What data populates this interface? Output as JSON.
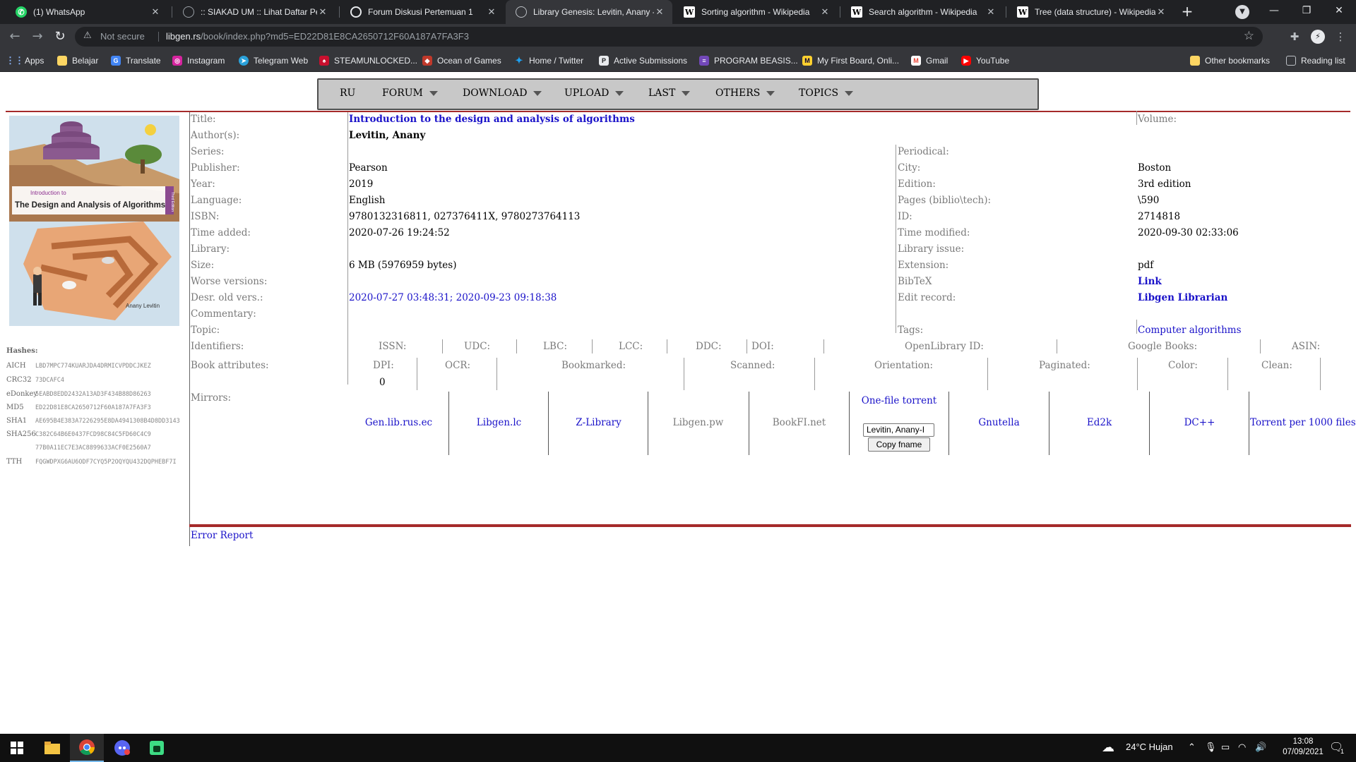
{
  "browser": {
    "tabs": [
      {
        "title": "(1) WhatsApp",
        "favicon": "whatsapp-icon",
        "color": "#25d366"
      },
      {
        "title": ":: SIAKAD UM :: Lihat Daftar Pe",
        "favicon": "globe-icon",
        "color": "#9aa0a6"
      },
      {
        "title": "Forum Diskusi Pertemuan 1",
        "favicon": "moodle-icon",
        "color": "#f98012"
      },
      {
        "title": "Library Genesis: Levitin, Anany -",
        "favicon": "globe-icon",
        "color": "#9aa0a6"
      },
      {
        "title": "Sorting algorithm - Wikipedia",
        "favicon": "wikipedia-icon",
        "color": "#ffffff"
      },
      {
        "title": "Search algorithm - Wikipedia",
        "favicon": "wikipedia-icon",
        "color": "#ffffff"
      },
      {
        "title": "Tree (data structure) - Wikipedia",
        "favicon": "wikipedia-icon",
        "color": "#ffffff"
      }
    ],
    "active_tab": 3,
    "not_secure": "Not secure",
    "url_host": "libgen.rs",
    "url_path": "/book/index.php?md5=ED22D81E8CA2650712F60A187A7FA3F3",
    "bookmarks": [
      {
        "label": "Apps",
        "icon": "apps-grid-icon",
        "color": "#4285f4"
      },
      {
        "label": "Belajar",
        "icon": "folder-icon",
        "color": "#fdd663"
      },
      {
        "label": "Translate",
        "icon": "translate-icon",
        "color": "#4285f4"
      },
      {
        "label": "Instagram",
        "icon": "instagram-icon",
        "color": "#d6249f"
      },
      {
        "label": "Telegram Web",
        "icon": "telegram-icon",
        "color": "#2aa1da"
      },
      {
        "label": "STEAMUNLOCKED...",
        "icon": "steamunlocked-icon",
        "color": "#c8102e"
      },
      {
        "label": "Ocean of Games",
        "icon": "ocean-of-games-icon",
        "color": "#c0392b"
      },
      {
        "label": "Home / Twitter",
        "icon": "twitter-icon",
        "color": "#1da1f2"
      },
      {
        "label": "Active Submissions",
        "icon": "submissions-icon",
        "color": "#e8eaed"
      },
      {
        "label": "PROGRAM BEASIS...",
        "icon": "form-icon",
        "color": "#7248b9"
      },
      {
        "label": "My First Board, Onli...",
        "icon": "miro-icon",
        "color": "#ffd02f"
      },
      {
        "label": "Gmail",
        "icon": "gmail-icon",
        "color": "#ea4335"
      },
      {
        "label": "YouTube",
        "icon": "youtube-icon",
        "color": "#ff0000"
      }
    ],
    "other_bookmarks": "Other bookmarks",
    "reading_list": "Reading list"
  },
  "menu": [
    {
      "label": "RU",
      "caret": false
    },
    {
      "label": "FORUM",
      "caret": true
    },
    {
      "label": "DOWNLOAD",
      "caret": true
    },
    {
      "label": "UPLOAD",
      "caret": true
    },
    {
      "label": "LAST",
      "caret": true
    },
    {
      "label": "OTHERS",
      "caret": true
    },
    {
      "label": "TOPICS",
      "caret": true
    }
  ],
  "cover": {
    "line1": "Introduction to",
    "line2": "The Design and Analysis of Algorithms",
    "edition": "Third Edition",
    "author": "Anany Levitin"
  },
  "book": {
    "title_label": "Title:",
    "title": "Introduction to the design and analysis of algorithms",
    "volume_label": "Volume:",
    "authors_label": "Author(s):",
    "authors": "Levitin, Anany",
    "series_label": "Series:",
    "periodical_label": "Periodical:",
    "publisher_label": "Publisher:",
    "publisher": "Pearson",
    "city_label": "City:",
    "city": "Boston",
    "year_label": "Year:",
    "year": "2019",
    "edition_label": "Edition:",
    "edition": "3rd edition",
    "language_label": "Language:",
    "language": "English",
    "pages_label": "Pages (biblio\\tech):",
    "pages": "\\590",
    "isbn_label": "ISBN:",
    "isbn": "9780132316811, 027376411X, 9780273764113",
    "id_label": "ID:",
    "id": "2714818",
    "time_added_label": "Time added:",
    "time_added": "2020-07-26 19:24:52",
    "time_modified_label": "Time modified:",
    "time_modified": "2020-09-30 02:33:06",
    "library_label": "Library:",
    "library_issue_label": "Library issue:",
    "size_label": "Size:",
    "size": "6 MB (5976959 bytes)",
    "extension_label": "Extension:",
    "extension": "pdf",
    "worse_versions_label": "Worse versions:",
    "bibtex_label": "BibTeX",
    "bibtex": "Link",
    "desr_label": "Desr. old vers.:",
    "desr_1": "2020-07-27 03:48:31",
    "desr_sep": "; ",
    "desr_2": "2020-09-23 09:18:38",
    "edit_record_label": "Edit record:",
    "edit_record": "Libgen Librarian",
    "commentary_label": "Commentary:",
    "topic_label": "Topic:",
    "tags_label": "Tags:",
    "tags": "Computer algorithms",
    "identifiers_label": "Identifiers:",
    "identifiers": [
      "ISSN:",
      "UDC:",
      "LBC:",
      "LCC:",
      "DDC:",
      "DOI:",
      "OpenLibrary ID:",
      "Google Books:",
      "ASIN:"
    ],
    "attributes_label": "Book attributes:",
    "attributes": [
      "DPI:",
      "OCR:",
      "Bookmarked:",
      "Scanned:",
      "Orientation:",
      "Paginated:",
      "Color:",
      "Clean:"
    ],
    "dpi_value": "0",
    "mirrors_label": "Mirrors:",
    "mirrors": [
      "Gen.lib.rus.ec",
      "Libgen.lc",
      "Z-Library",
      "Libgen.pw",
      "BookFI.net",
      "One-file torrent",
      "Gnutella",
      "Ed2k",
      "DC++",
      "Torrent per 1000 files"
    ],
    "fname_value": "Levitin, Anany-I",
    "copy_fname": "Copy fname",
    "error_report": "Error Report"
  },
  "hashes": {
    "title": "Hashes:",
    "items": [
      {
        "label": "AICH",
        "value": "LBD7MPC774KUARJDA4DRMICVPDDCJKEZ"
      },
      {
        "label": "CRC32",
        "value": "73DCAFC4"
      },
      {
        "label": "eDonkey",
        "value": "5EABD8EDD2432A13AD3F434B88D86263"
      },
      {
        "label": "MD5",
        "value": "ED22D81E8CA2650712F60A187A7FA3F3"
      },
      {
        "label": "SHA1",
        "value": "AE695B4E383A7226295E8DA4941308B4D8DD3143"
      },
      {
        "label": "SHA256",
        "value": "C382C64B6E0437FCD98C84C5FD60C4C9"
      },
      {
        "label": "",
        "value": "77B0A11EC7E3AC8899633ACF0E2560A7"
      },
      {
        "label": "TTH",
        "value": "FQGWDPXG6AU6ODF7CYQ5P2OQYQU432DQPHEBF7I"
      }
    ]
  },
  "taskbar": {
    "weather": "24°C  Hujan",
    "time": "13:08",
    "date": "07/09/2021",
    "notification_count": "1"
  }
}
